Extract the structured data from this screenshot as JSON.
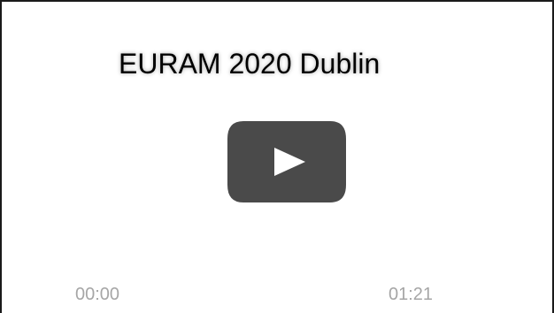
{
  "video": {
    "title": "EURAM 2020 Dublin",
    "current_time": "00:00",
    "duration": "01:21"
  },
  "icons": {
    "play": "play-icon"
  },
  "colors": {
    "play_button_bg": "#4a4a4a",
    "play_glyph": "#ffffff",
    "time_text": "#a6a6a6",
    "title_text": "#000000"
  }
}
